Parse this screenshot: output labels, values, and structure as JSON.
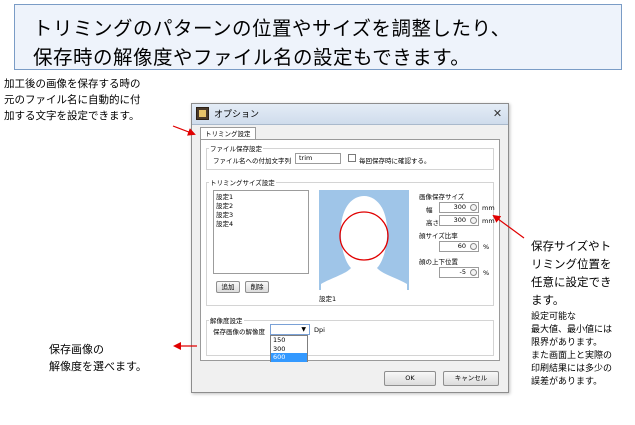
{
  "headline": {
    "line1": "トリミングのパターンの位置やサイズを調整したり、",
    "line2": "保存時の解像度やファイル名の設定もできます。"
  },
  "annotations": {
    "top_left": [
      "加工後の画像を保存する時の",
      "元のファイル名に自動的に付",
      "加する文字を設定できます。"
    ],
    "right_title": [
      "保存サイズやト",
      "リミング位置を",
      "任意に設定でき",
      "ます。"
    ],
    "right_detail": [
      "設定可能な",
      "最大値、最小値には",
      "限界があります。",
      "また画面上と実際の",
      "印刷結果には多少の",
      "誤差があります。"
    ],
    "bottom_left": [
      "保存画像の",
      "解像度を選べます。"
    ]
  },
  "dialog": {
    "title": "オプション",
    "close": "✕",
    "tab": "トリミング設定",
    "file_section": {
      "legend": "ファイル保存設定",
      "suffix_label": "ファイル名への付加文字列",
      "suffix_value": "trim",
      "confirm_label": "毎回保存時に確認する。"
    },
    "trim_section": {
      "legend": "トリミングサイズ設定",
      "presets": [
        "設定1",
        "設定2",
        "設定3",
        "設定4"
      ],
      "add_button": "追加",
      "delete_button": "削除",
      "preview_caption": "設定1",
      "save_size_label": "画像保存サイズ",
      "width_label": "幅",
      "width_value": "300",
      "height_label": "高さ",
      "height_value": "300",
      "unit_mm": "mm",
      "face_ratio_label": "顔サイズ比率",
      "face_ratio_value": "60",
      "face_pos_label": "顔の上下位置",
      "face_pos_value": "-5",
      "unit_percent": "%"
    },
    "resolution_section": {
      "legend": "解像度設定",
      "label": "保存画像の解像度",
      "selected": "",
      "unit": "Dpi",
      "options": [
        "150",
        "300",
        "600"
      ],
      "highlighted": "600"
    },
    "ok_button": "OK",
    "cancel_button": "キャンセル"
  },
  "colors": {
    "headline_border": "#7a9cc6",
    "headline_bg": "#eef3fb",
    "arrow": "#e00000",
    "preview_bg": "#9fc5e8",
    "circle": "#e00000",
    "dropdown_highlight": "#3399ff"
  }
}
